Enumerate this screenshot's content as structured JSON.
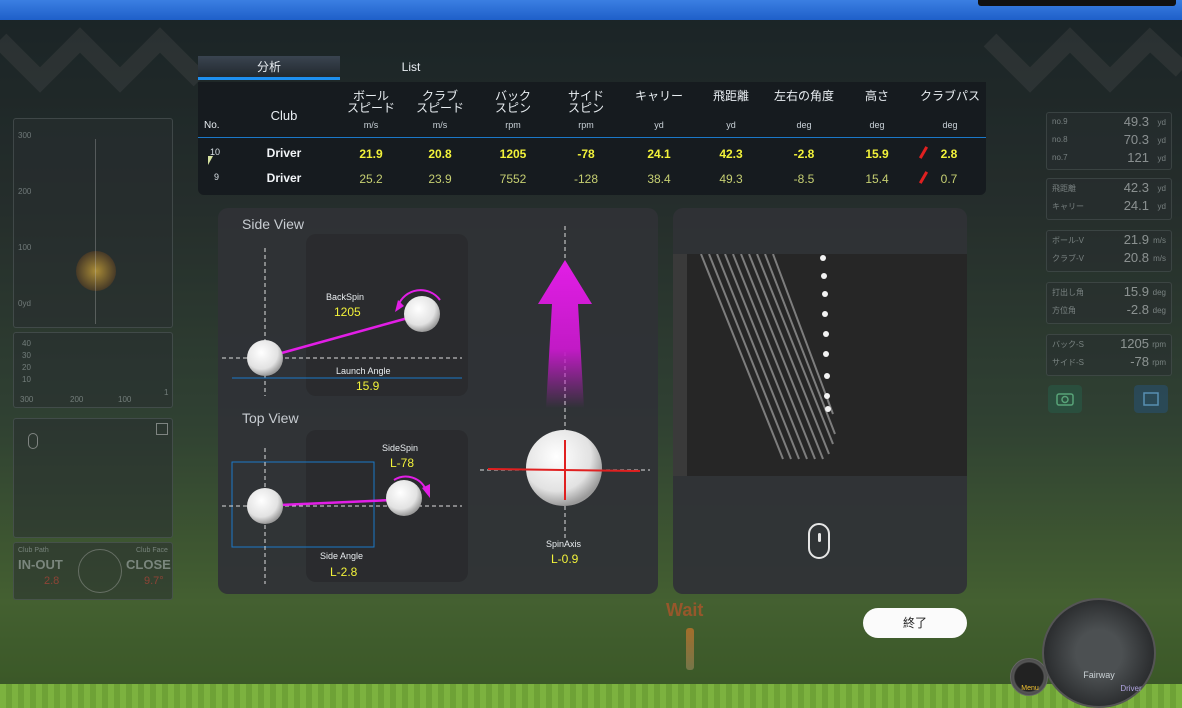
{
  "tabs": {
    "analysis": "分析",
    "list": "List"
  },
  "table": {
    "headers": [
      {
        "label": "No.",
        "unit": ""
      },
      {
        "label": "Club",
        "unit": ""
      },
      {
        "label": "ボール\nスピード",
        "unit": "m/s"
      },
      {
        "label": "クラブ\nスピード",
        "unit": "m/s"
      },
      {
        "label": "バック\nスピン",
        "unit": "rpm"
      },
      {
        "label": "サイド\nスピン",
        "unit": "rpm"
      },
      {
        "label": "キャリー",
        "unit": "yd"
      },
      {
        "label": "飛距離",
        "unit": "yd"
      },
      {
        "label": "左右の角度",
        "unit": "deg"
      },
      {
        "label": "高さ",
        "unit": "deg"
      },
      {
        "label": "クラブパス",
        "unit": "deg"
      }
    ],
    "rows": [
      {
        "no": "10",
        "club": "Driver",
        "ball_speed": "21.9",
        "club_speed": "20.8",
        "back_spin": "1205",
        "side_spin": "-78",
        "carry": "24.1",
        "distance": "42.3",
        "lr_angle": "-2.8",
        "height": "15.9",
        "club_path": "2.8"
      },
      {
        "no": "9",
        "club": "Driver",
        "ball_speed": "25.2",
        "club_speed": "23.9",
        "back_spin": "7552",
        "side_spin": "-128",
        "carry": "38.4",
        "distance": "49.3",
        "lr_angle": "-8.5",
        "height": "15.4",
        "club_path": "0.7"
      }
    ]
  },
  "side_view": {
    "title": "Side View",
    "backspin_label": "BackSpin",
    "backspin_value": "1205",
    "launch_label": "Launch Angle",
    "launch_value": "15.9"
  },
  "top_view": {
    "title": "Top View",
    "sidespin_label": "SideSpin",
    "sidespin_value": "L-78",
    "side_angle_label": "Side Angle",
    "side_angle_value": "L-2.8"
  },
  "spin_axis": {
    "label": "SpinAxis",
    "value": "L-0.9"
  },
  "end_button": "終了",
  "background": {
    "left_scale": [
      "300",
      "200",
      "100",
      "0yd"
    ],
    "left_small_scale": [
      "40",
      "30",
      "20",
      "10"
    ],
    "left_axis": [
      "300",
      "200",
      "100",
      "1"
    ],
    "club_path_label": "Club Path",
    "club_path_value": "IN-OUT",
    "club_path_num": "2.8",
    "club_face_label": "Club Face",
    "club_face_value": "CLOSE",
    "club_face_num": "9.7°",
    "right_group1": [
      {
        "k": "no.9",
        "v": "49.3",
        "u": "yd"
      },
      {
        "k": "no.8",
        "v": "70.3",
        "u": "yd"
      },
      {
        "k": "no.7",
        "v": "121",
        "u": "yd"
      }
    ],
    "right_group2": [
      {
        "k": "飛距離",
        "v": "42.3",
        "u": "yd"
      },
      {
        "k": "キャリー",
        "v": "24.1",
        "u": "yd"
      }
    ],
    "right_group3": [
      {
        "k": "ボール-V",
        "v": "21.9",
        "u": "m/s"
      },
      {
        "k": "クラブ-V",
        "v": "20.8",
        "u": "m/s"
      }
    ],
    "right_group4": [
      {
        "k": "打出し角",
        "v": "15.9",
        "u": "deg"
      },
      {
        "k": "方位角",
        "v": "-2.8",
        "u": "deg"
      }
    ],
    "right_group5": [
      {
        "k": "バック-S",
        "v": "1205",
        "u": "rpm"
      },
      {
        "k": "サイド-S",
        "v": "-78",
        "u": "rpm"
      }
    ],
    "wait_text": "Wait",
    "menu_label": "Menu",
    "dial_label": "Fairway",
    "dial_sub": "Driver"
  },
  "colors": {
    "accent_blue": "#1e8ff0",
    "value_yellow": "#f2f23a",
    "magenta": "#e21ee6",
    "red_path": "#e02020"
  }
}
